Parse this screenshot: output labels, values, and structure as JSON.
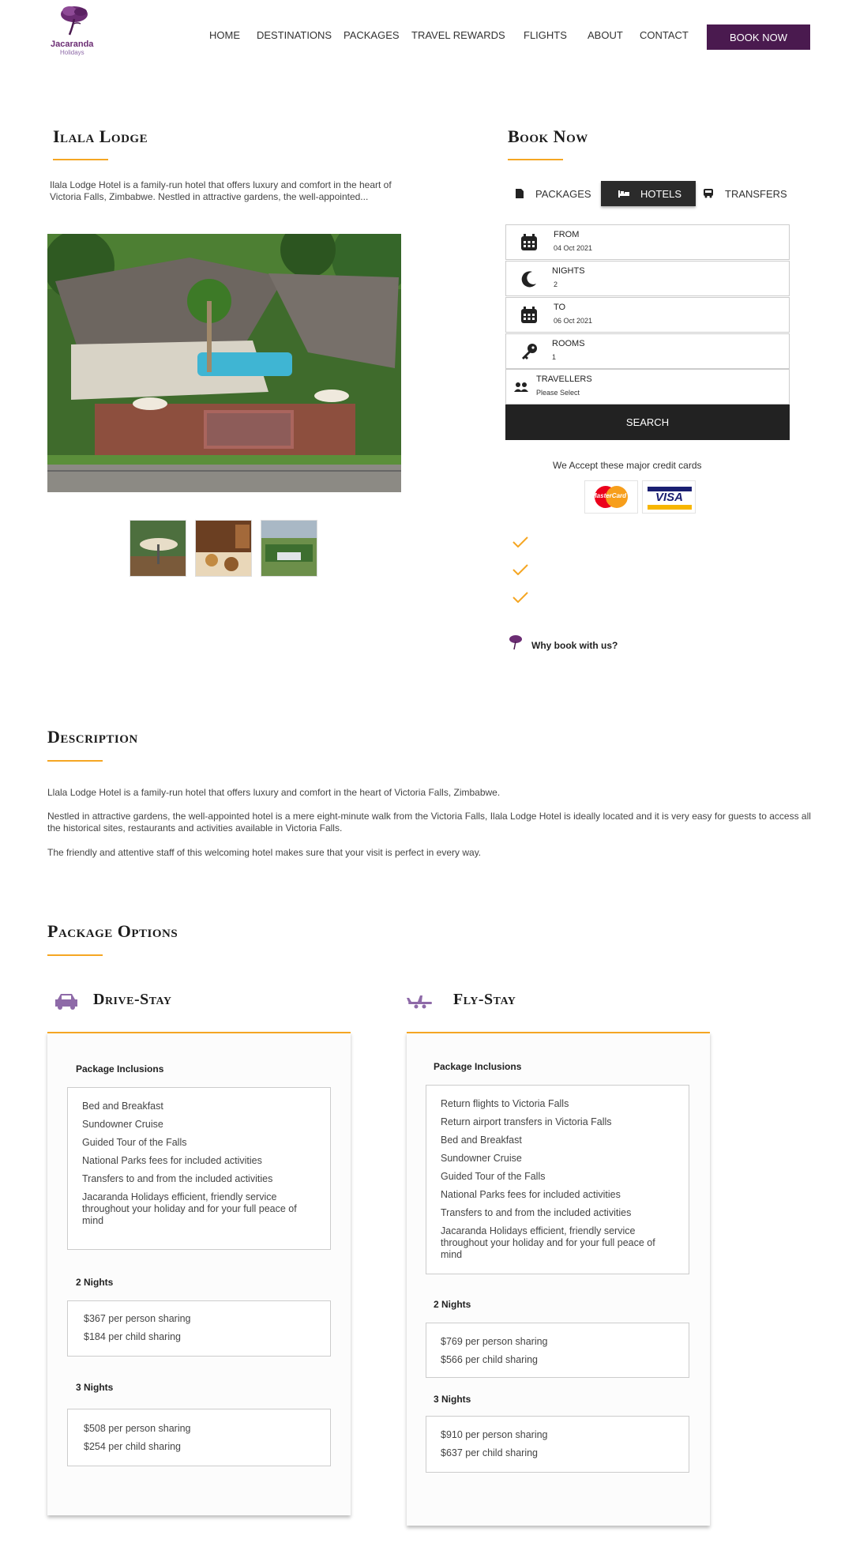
{
  "brand": {
    "name": "Jacaranda",
    "sub": "Holidays",
    "color": "#4a1a4f"
  },
  "nav": {
    "items": [
      {
        "label": "HOME"
      },
      {
        "label": "DESTINATIONS"
      },
      {
        "label": "PACKAGES"
      },
      {
        "label": "TRAVEL REWARDS"
      },
      {
        "label": "FLIGHTS"
      },
      {
        "label": "ABOUT"
      },
      {
        "label": "CONTACT"
      }
    ],
    "cta": "BOOK NOW"
  },
  "hotel": {
    "title": "Ilala Lodge",
    "intro": "Ilala Lodge Hotel is a family-run hotel that offers luxury and comfort in the heart of Victoria Falls, Zimbabwe. Nestled in attractive gardens, the well-appointed..."
  },
  "booking": {
    "title": "Book Now",
    "tabs": [
      {
        "label": "PACKAGES",
        "icon": "document-icon"
      },
      {
        "label": "HOTELS",
        "icon": "bed-icon",
        "active": true
      },
      {
        "label": "TRANSFERS",
        "icon": "bus-icon"
      }
    ],
    "fields": {
      "from": {
        "label": "FROM",
        "value": "04 Oct 2021"
      },
      "nights": {
        "label": "NIGHTS",
        "value": "2"
      },
      "to": {
        "label": "TO",
        "value": "06 Oct 2021"
      },
      "rooms": {
        "label": "ROOMS",
        "value": "1"
      },
      "travellers": {
        "label": "TRAVELLERS",
        "value": "Please Select"
      }
    },
    "search": "SEARCH",
    "cards_text": "We Accept these major credit cards",
    "cards": {
      "mastercard": "MasterCard",
      "visa": "VISA"
    },
    "why": "Why book with us?"
  },
  "description": {
    "title": "Description",
    "paragraphs": [
      "Llala Lodge Hotel is a family-run hotel that offers luxury and comfort in the heart of Victoria Falls, Zimbabwe.",
      "Nestled in attractive gardens, the well-appointed hotel is a mere eight-minute walk from the Victoria Falls, Ilala Lodge Hotel is ideally located and it is very easy for guests to access all the historical sites, restaurants and activities available in Victoria Falls.",
      "The friendly and attentive staff of this welcoming hotel makes sure that your visit is perfect in every way."
    ]
  },
  "packages": {
    "title": "Package Options",
    "drive": {
      "title": "Drive-Stay",
      "inclusions_label": "Package Inclusions",
      "inclusions": [
        "Bed and Breakfast",
        "Sundowner Cruise",
        "Guided Tour of the Falls",
        "National Parks fees for included activities",
        "Transfers to and from the included activities",
        "Jacaranda Holidays efficient, friendly service throughout your holiday and for your full peace of mind"
      ],
      "two_nights_label": "2 Nights",
      "two_nights": [
        "$367 per person sharing",
        "$184 per child sharing"
      ],
      "three_nights_label": "3 Nights",
      "three_nights": [
        "$508 per person sharing",
        "$254 per child sharing"
      ]
    },
    "fly": {
      "title": "Fly-Stay",
      "inclusions_label": "Package Inclusions",
      "inclusions": [
        "Return flights to Victoria Falls",
        "Return airport transfers in Victoria Falls",
        "Bed and Breakfast",
        "Sundowner Cruise",
        "Guided Tour of the Falls",
        "National Parks fees for included activities",
        "Transfers to and from the included activities",
        "Jacaranda Holidays efficient, friendly service throughout your holiday and for your full peace of mind"
      ],
      "two_nights_label": "2 Nights",
      "two_nights": [
        "$769 per person sharing",
        "$566 per child sharing"
      ],
      "three_nights_label": "3 Nights",
      "three_nights": [
        "$910 per person sharing",
        "$637 per child sharing"
      ]
    }
  },
  "colors": {
    "accent": "#f5a623",
    "brand": "#4a1a4f",
    "dark": "#222222",
    "icon_purple": "#8e6aa8"
  }
}
